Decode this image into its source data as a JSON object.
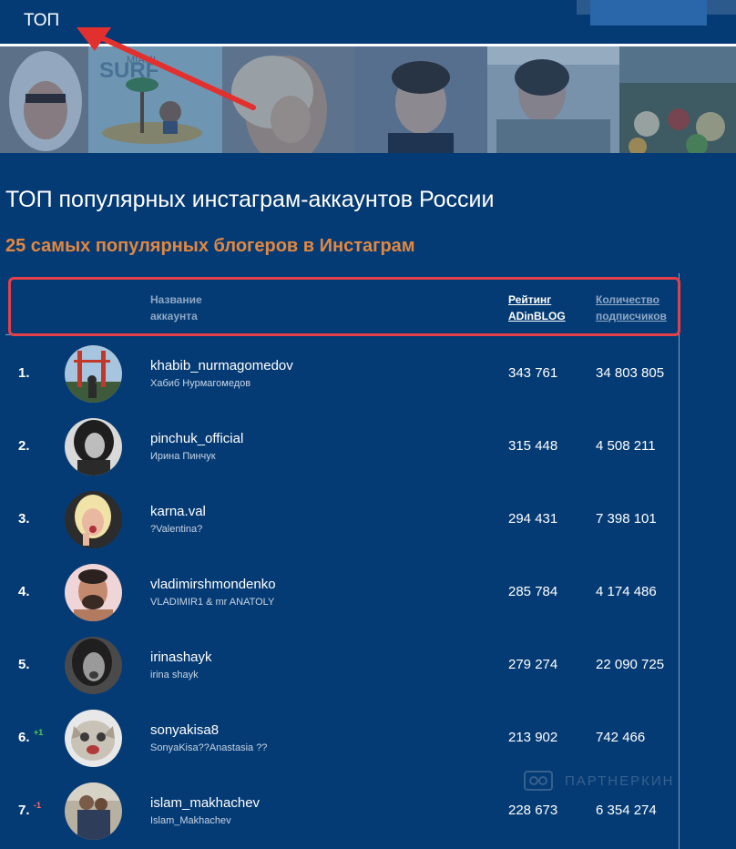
{
  "nav": {
    "top_label": "ТОП"
  },
  "page": {
    "title": "ТОП популярных инстаграм-аккаунтов России",
    "subtitle": "25 самых популярных блогеров в Инстаграм"
  },
  "banner": {
    "tile2_text_top": "MIAMI",
    "tile2_text_main": "SURF"
  },
  "table": {
    "headers": {
      "name_line1": "Название",
      "name_line2": "аккаунта",
      "rating_line1": "Рейтинг",
      "rating_line2": "ADinBLOG",
      "subs_line1": "Количество",
      "subs_line2": "подписчиков"
    },
    "rows": [
      {
        "rank": "1.",
        "delta": "",
        "username": "khabib_nurmagomedov",
        "fullname": "Хабиб Нурмагомедов",
        "rating": "343 761",
        "subscribers": "34 803 805"
      },
      {
        "rank": "2.",
        "delta": "",
        "username": "pinchuk_official",
        "fullname": "Ирина Пинчук",
        "rating": "315 448",
        "subscribers": "4 508 211"
      },
      {
        "rank": "3.",
        "delta": "",
        "username": "karna.val",
        "fullname": "?Valentina?",
        "rating": "294 431",
        "subscribers": "7 398 101"
      },
      {
        "rank": "4.",
        "delta": "",
        "username": "vladimirshmondenko",
        "fullname": "VLADIMIR1 & mr ANATOLY",
        "rating": "285 784",
        "subscribers": "4 174 486"
      },
      {
        "rank": "5.",
        "delta": "",
        "username": "irinashayk",
        "fullname": "irina shayk",
        "rating": "279 274",
        "subscribers": "22 090 725"
      },
      {
        "rank": "6.",
        "delta": "+1",
        "username": "sonyakisa8",
        "fullname": "SonyaKisa??Anastasia ??",
        "rating": "213 902",
        "subscribers": "742 466"
      },
      {
        "rank": "7.",
        "delta": "-1",
        "username": "islam_makhachev",
        "fullname": "Islam_Makhachev",
        "rating": "228 673",
        "subscribers": "6 354 274"
      }
    ]
  },
  "watermark": {
    "text": "ПАРТНЕРКИН"
  },
  "colors": {
    "background": "#053b74",
    "accent_orange": "#e3873f",
    "highlight_red": "#e4404a",
    "delta_up": "#4fd14f",
    "delta_down": "#ff6a6a"
  }
}
